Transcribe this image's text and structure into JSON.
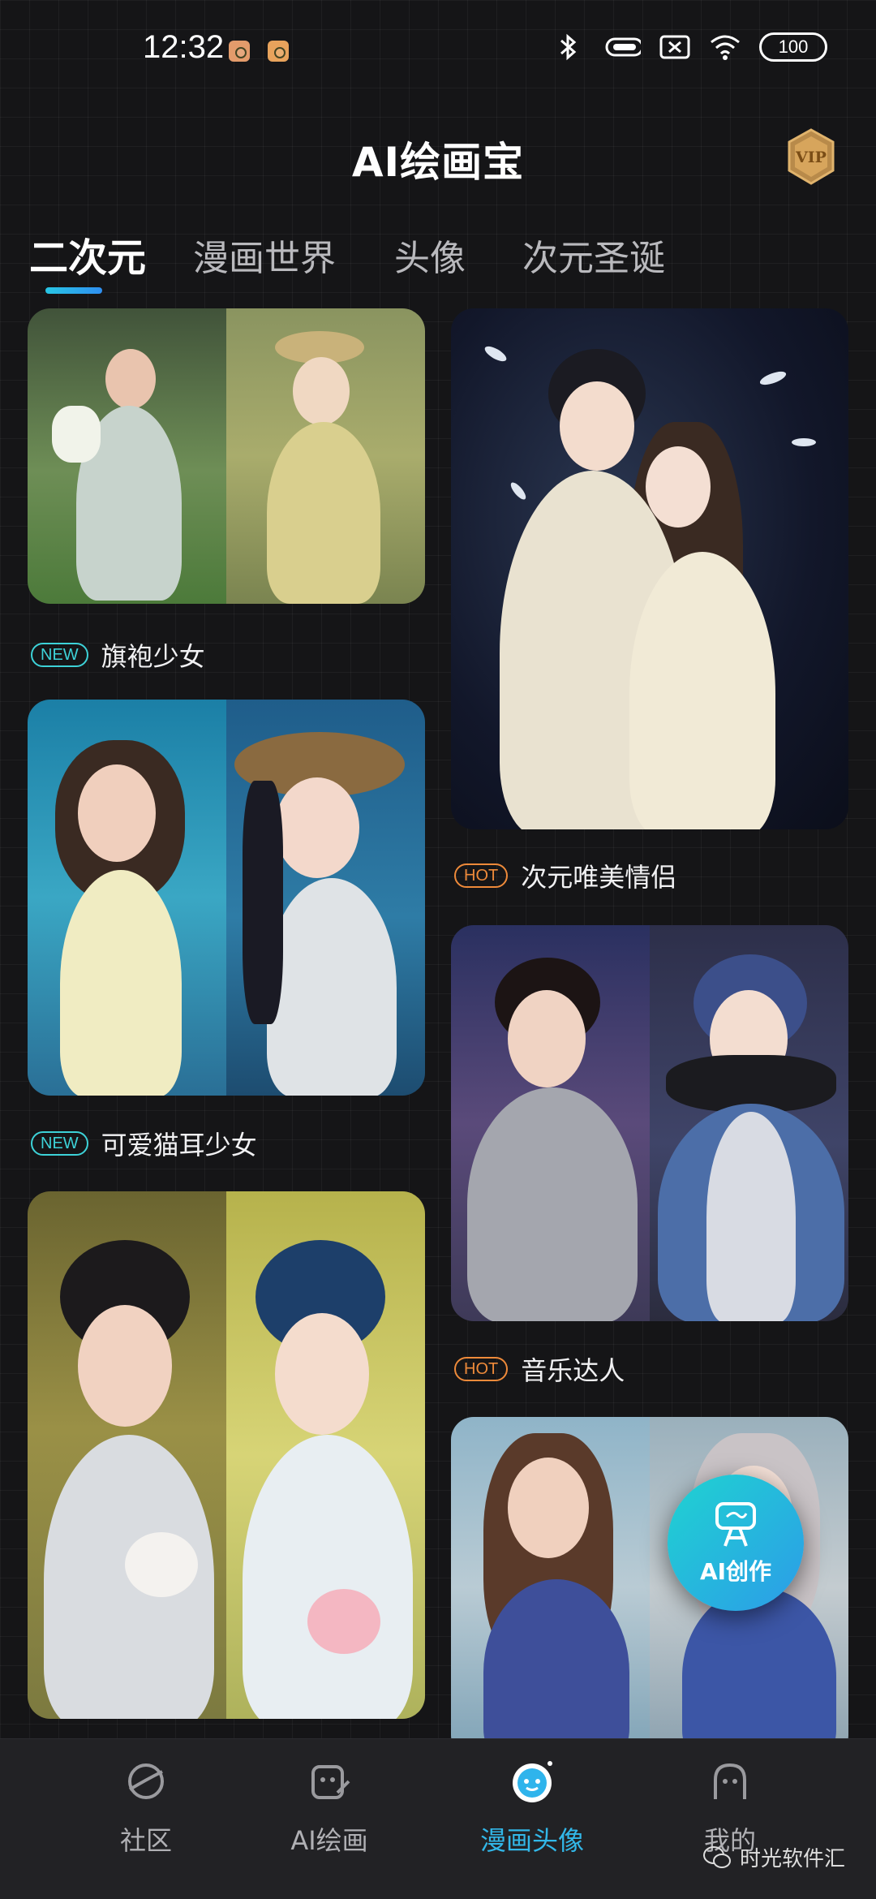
{
  "status_bar": {
    "time": "12:32",
    "battery": "100"
  },
  "header": {
    "title": "AI绘画宝",
    "vip_label": "VIP"
  },
  "tabs": [
    {
      "label": "二次元",
      "active": true
    },
    {
      "label": "漫画世界",
      "active": false
    },
    {
      "label": "头像",
      "active": false
    },
    {
      "label": "次元圣诞",
      "active": false
    }
  ],
  "cards": [
    {
      "tag": "NEW",
      "title": "旗袍少女"
    },
    {
      "tag": "NEW",
      "title": "可爱猫耳少女"
    },
    {
      "tag": "",
      "title": ""
    },
    {
      "tag": "HOT",
      "title": "次元唯美情侣"
    },
    {
      "tag": "HOT",
      "title": "音乐达人"
    },
    {
      "tag": "",
      "title": ""
    }
  ],
  "fab": {
    "label": "AI创作"
  },
  "bottom_nav": [
    {
      "label": "社区",
      "icon": "planet-icon",
      "active": false
    },
    {
      "label": "AI绘画",
      "icon": "palette-icon",
      "active": false
    },
    {
      "label": "漫画头像",
      "icon": "avatar-face-icon",
      "active": true
    },
    {
      "label": "我的",
      "icon": "profile-icon",
      "active": false
    }
  ],
  "watermark": {
    "text": "时光软件汇"
  },
  "colors": {
    "accent": "#32b7e8",
    "new_tag": "#3dd2d8",
    "hot_tag": "#ee8a3a",
    "background": "#151517"
  }
}
